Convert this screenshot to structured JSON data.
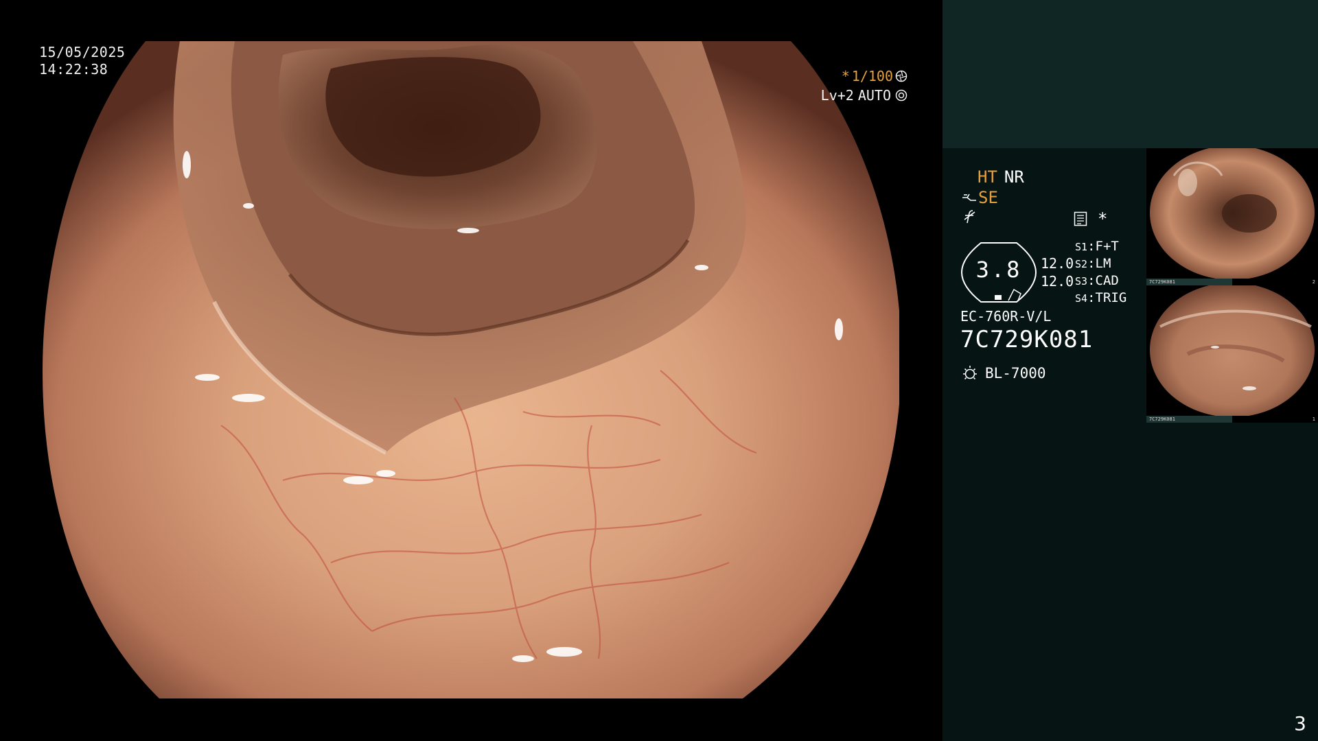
{
  "main_view": {
    "date": "15/05/2025",
    "time": "14:22:38",
    "shutter": "1/100",
    "shutter_prefix": "*",
    "level": "Lv+2",
    "mode": "AUTO"
  },
  "panel": {
    "ht_label": "HT",
    "nr_label": "NR",
    "se_label": "SE",
    "asterisk": "*",
    "gauge_value": "3.8",
    "exposure_values": [
      "12.0",
      "12.0"
    ],
    "settings": [
      {
        "key": "S1",
        "value": "F+T"
      },
      {
        "key": "S2",
        "value": "LM"
      },
      {
        "key": "S3",
        "value": "CAD"
      },
      {
        "key": "S4",
        "value": "TRIG"
      }
    ],
    "scope_model": "EC-760R-V/L",
    "serial_number": "7C729K081",
    "light_source": "BL-7000"
  },
  "thumbnails": [
    {
      "index": "2",
      "label": "7C729K081"
    },
    {
      "index": "1",
      "label": "7C729K081"
    }
  ],
  "page_number": "3",
  "colors": {
    "accent_orange": "#e8a13a",
    "panel_bg": "#061514",
    "panel_top_bg": "#0f2624"
  },
  "icons": [
    "shutter-aperture-icon",
    "auto-iris-icon",
    "structure-enhance-icon",
    "color-f-icon",
    "document-icon",
    "light-source-icon"
  ]
}
